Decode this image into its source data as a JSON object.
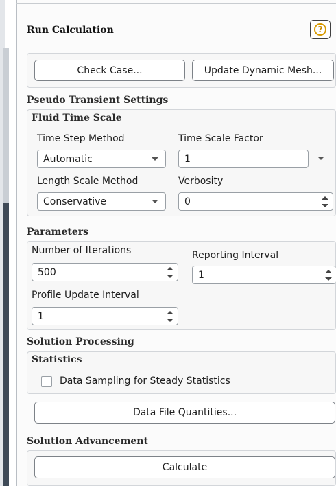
{
  "panel": {
    "title": "Run Calculation",
    "help_icon": "help-icon",
    "help_glyph": "?"
  },
  "top_buttons": {
    "check_case": "Check Case...",
    "update_dynamic_mesh": "Update Dynamic Mesh..."
  },
  "pseudo_transient": {
    "heading": "Pseudo Transient Settings",
    "fluid_time_scale": {
      "heading": "Fluid Time Scale",
      "time_step_method_label": "Time Step Method",
      "time_step_method_value": "Automatic",
      "time_scale_factor_label": "Time Scale Factor",
      "time_scale_factor_value": "1",
      "length_scale_method_label": "Length Scale Method",
      "length_scale_method_value": "Conservative",
      "verbosity_label": "Verbosity",
      "verbosity_value": "0"
    }
  },
  "parameters": {
    "heading": "Parameters",
    "number_of_iterations_label": "Number of Iterations",
    "number_of_iterations_value": "500",
    "reporting_interval_label": "Reporting Interval",
    "reporting_interval_value": "1",
    "profile_update_interval_label": "Profile Update Interval",
    "profile_update_interval_value": "1"
  },
  "solution_processing": {
    "heading": "Solution Processing",
    "statistics": {
      "heading": "Statistics",
      "data_sampling_label": "Data Sampling for Steady Statistics",
      "data_sampling_checked": false
    },
    "data_file_quantities": "Data File Quantities..."
  },
  "solution_advancement": {
    "heading": "Solution Advancement",
    "calculate": "Calculate"
  },
  "colors": {
    "accent_help": "#d89a00",
    "border": "#7d8288",
    "group_bg": "#f7f7f7"
  }
}
